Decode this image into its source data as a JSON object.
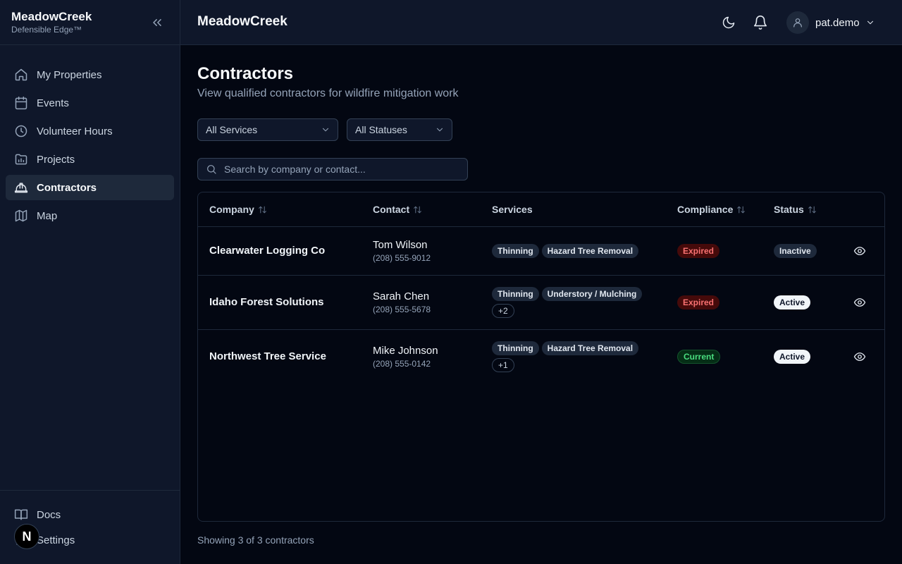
{
  "sidebar": {
    "brand_name": "MeadowCreek",
    "brand_tag": "Defensible Edge™",
    "items": [
      {
        "label": "My Properties",
        "icon": "home-icon"
      },
      {
        "label": "Events",
        "icon": "calendar-icon"
      },
      {
        "label": "Volunteer Hours",
        "icon": "clock-icon"
      },
      {
        "label": "Projects",
        "icon": "folder-chart-icon"
      },
      {
        "label": "Contractors",
        "icon": "hard-hat-icon",
        "active": true
      },
      {
        "label": "Map",
        "icon": "map-icon"
      }
    ],
    "bottom_items": [
      {
        "label": "Docs",
        "icon": "book-icon"
      },
      {
        "label": "Settings",
        "icon": "gear-icon"
      }
    ],
    "badge": "N"
  },
  "topbar": {
    "title": "MeadowCreek",
    "username": "pat.demo"
  },
  "page": {
    "title": "Contractors",
    "subtitle": "View qualified contractors for wildfire mitigation work"
  },
  "filters": {
    "services_selected": "All Services",
    "status_selected": "All Statuses"
  },
  "search": {
    "placeholder": "Search by company or contact..."
  },
  "table": {
    "headers": {
      "company": "Company",
      "contact": "Contact",
      "services": "Services",
      "compliance": "Compliance",
      "status": "Status"
    },
    "rows": [
      {
        "company": "Clearwater Logging Co",
        "contact_name": "Tom Wilson",
        "contact_phone": "(208) 555-9012",
        "services": [
          "Thinning",
          "Hazard Tree Removal"
        ],
        "more": "",
        "compliance": "Expired",
        "status": "Inactive"
      },
      {
        "company": "Idaho Forest Solutions",
        "contact_name": "Sarah Chen",
        "contact_phone": "(208) 555-5678",
        "services": [
          "Thinning",
          "Understory / Mulching"
        ],
        "more": "+2",
        "compliance": "Expired",
        "status": "Active"
      },
      {
        "company": "Northwest Tree Service",
        "contact_name": "Mike Johnson",
        "contact_phone": "(208) 555-0142",
        "services": [
          "Thinning",
          "Hazard Tree Removal"
        ],
        "more": "+1",
        "compliance": "Current",
        "status": "Active"
      }
    ]
  },
  "footer": {
    "count_text": "Showing 3 of 3 contractors"
  },
  "colors": {
    "background": "#030712",
    "sidebar": "#0f172a",
    "expired": "#f87171",
    "current": "#4ade80"
  }
}
